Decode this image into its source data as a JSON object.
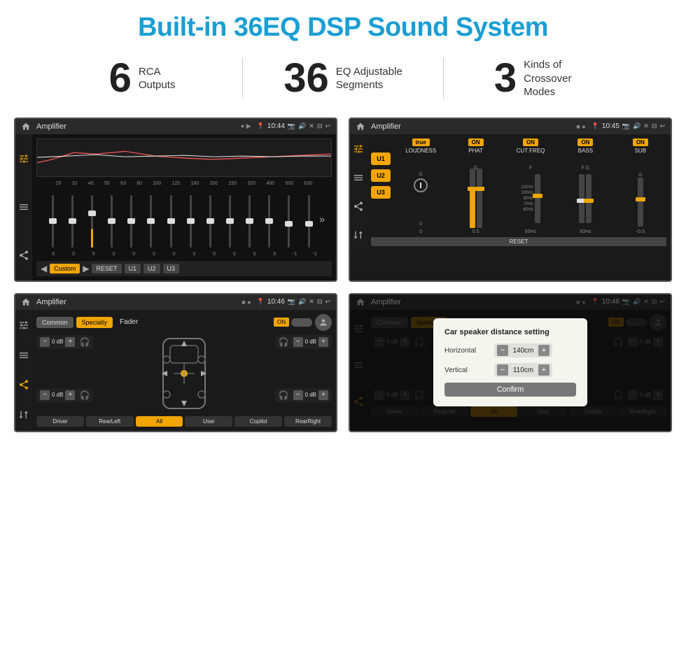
{
  "page": {
    "title": "Built-in 36EQ DSP Sound System",
    "title_color": "#1a9ed4"
  },
  "stats": [
    {
      "number": "6",
      "label": "RCA\nOutputs"
    },
    {
      "number": "36",
      "label": "EQ Adjustable\nSegments"
    },
    {
      "number": "3",
      "label": "Kinds of\nCrossover Modes"
    }
  ],
  "screen1": {
    "app_name": "Amplifier",
    "time": "10:44",
    "eq_freqs": [
      "25",
      "32",
      "40",
      "50",
      "63",
      "80",
      "100",
      "125",
      "160",
      "200",
      "250",
      "320",
      "400",
      "500",
      "630"
    ],
    "eq_values": [
      "0",
      "0",
      "5",
      "0",
      "0",
      "0",
      "0",
      "0",
      "0",
      "0",
      "0",
      "0",
      "-1",
      "-1"
    ],
    "buttons": [
      "Custom",
      "RESET",
      "U1",
      "U2",
      "U3"
    ]
  },
  "screen2": {
    "app_name": "Amplifier",
    "time": "10:45",
    "presets": [
      "U1",
      "U2",
      "U3"
    ],
    "controls": [
      {
        "label": "LOUDNESS",
        "on": true
      },
      {
        "label": "PHAT",
        "on": true
      },
      {
        "label": "CUT FREQ",
        "on": true
      },
      {
        "label": "BASS",
        "on": true
      },
      {
        "label": "SUB",
        "on": true
      }
    ],
    "reset_btn": "RESET"
  },
  "screen3": {
    "app_name": "Amplifier",
    "time": "10:46",
    "tabs": [
      "Common",
      "Specialty"
    ],
    "fader_label": "Fader",
    "on_toggle": "ON",
    "volumes": [
      {
        "val": "0 dB",
        "pos": "top-left"
      },
      {
        "val": "0 dB",
        "pos": "top-right"
      },
      {
        "val": "0 dB",
        "pos": "bottom-left"
      },
      {
        "val": "0 dB",
        "pos": "bottom-right"
      }
    ],
    "nav_buttons": [
      "Driver",
      "RearLeft",
      "All",
      "User",
      "Copilot",
      "RearRight"
    ]
  },
  "screen4": {
    "app_name": "Amplifier",
    "time": "10:46",
    "tabs": [
      "Common",
      "Specialty"
    ],
    "on_toggle": "ON",
    "dialog": {
      "title": "Car speaker distance setting",
      "horizontal_label": "Horizontal",
      "horizontal_value": "140cm",
      "vertical_label": "Vertical",
      "vertical_value": "110cm",
      "confirm_label": "Confirm"
    }
  }
}
